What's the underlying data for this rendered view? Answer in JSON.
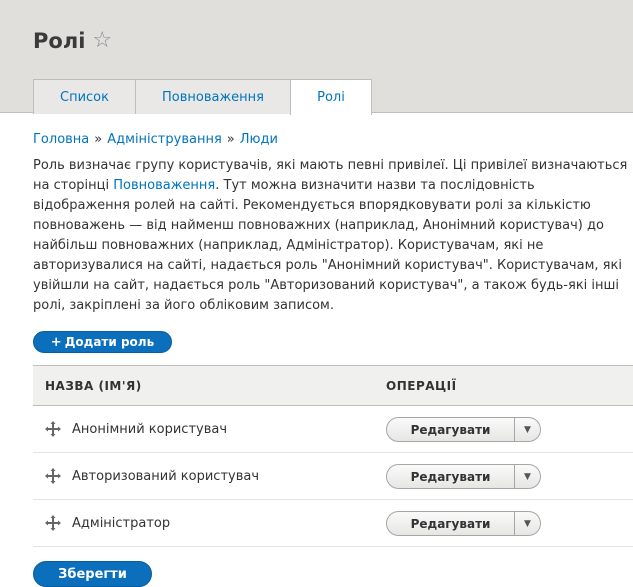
{
  "page": {
    "title": "Ролі",
    "star_icon": "star-outline-icon"
  },
  "tabs": [
    {
      "label": "Список",
      "active": false
    },
    {
      "label": "Повноваження",
      "active": false
    },
    {
      "label": "Ролі",
      "active": true
    }
  ],
  "breadcrumb": {
    "items": [
      "Головна",
      "Адміністрування",
      "Люди"
    ],
    "separator": "»"
  },
  "description": {
    "before_link": "Роль визначає групу користувачів, які мають певні привілеї. Ці привілеї визначаються на сторінці ",
    "link": "Повноваження",
    "after_link": ". Тут можна визначити назви та послідовність відображення ролей на сайті. Рекомендується впорядковувати ролі за кількістю повноважень — від найменш повноважних (наприклад, Анонімний користувач) до найбільш повноважних (наприклад, Адміністратор). Користувачам, які не авторизувалися на сайті, надається роль \"Анонімний користувач\". Користувачам, які увійшли на сайт, надається роль \"Авторизований користувач\", а також будь-які інші ролі, закріплені за його обліковим записом."
  },
  "add_button": {
    "plus": "+",
    "label": "Додати роль"
  },
  "table": {
    "col_name": "НАЗВА (ІМ'Я)",
    "col_ops": "ОПЕРАЦІЇ",
    "rows": [
      {
        "name": "Анонімний користувач",
        "action": "Редагувати"
      },
      {
        "name": "Авторизований користувач",
        "action": "Редагувати"
      },
      {
        "name": "Адміністратор",
        "action": "Редагувати"
      }
    ]
  },
  "save_button": {
    "label": "Зберегти"
  },
  "colors": {
    "link": "#0074bd",
    "primary_button": "#0b6fbc",
    "header_bg": "#e0dfdc"
  }
}
